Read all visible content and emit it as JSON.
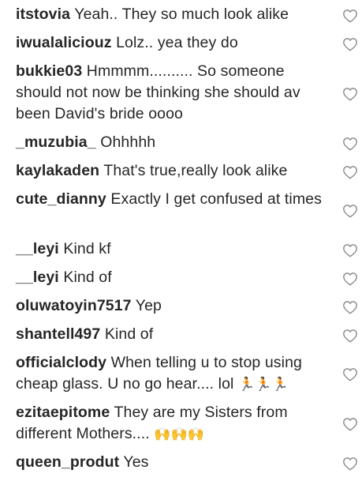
{
  "comments": [
    {
      "username": "itstovia",
      "text": "Yeah.. They so much look alike",
      "emoji": ""
    },
    {
      "username": "iwualaliciouz",
      "text": "Lolz.. yea they do",
      "emoji": ""
    },
    {
      "username": "bukkie03",
      "text": "Hmmmm.......... So someone should not now be thinking she should av been David's bride oooo",
      "emoji": ""
    },
    {
      "username": "_muzubia_",
      "text": "Ohhhhh",
      "emoji": ""
    },
    {
      "username": "kaylakaden",
      "text": "That's true,really look alike",
      "emoji": ""
    },
    {
      "username": "cute_dianny",
      "text": "Exactly I get confused at times",
      "emoji": ""
    },
    {
      "username": "__leyi",
      "text": "Kind kf",
      "emoji": ""
    },
    {
      "username": "__leyi",
      "text": "Kind of",
      "emoji": ""
    },
    {
      "username": "oluwatoyin7517",
      "text": "Yep",
      "emoji": ""
    },
    {
      "username": "shantell497",
      "text": "Kind of",
      "emoji": ""
    },
    {
      "username": "officialclody",
      "text": "When telling u to stop using cheap glass. U no go hear.... lol",
      "emoji": "🏃🏃🏃"
    },
    {
      "username": "ezitaepitome",
      "text": "They are my Sisters from different Mothers....",
      "emoji": "🙌🙌🙌"
    },
    {
      "username": "queen_produt",
      "text": "Yes",
      "emoji": ""
    }
  ],
  "icons": {
    "like": "heart-outline-icon"
  },
  "colors": {
    "text": "#262626",
    "icon": "#8e8e8e",
    "background": "#ffffff"
  }
}
